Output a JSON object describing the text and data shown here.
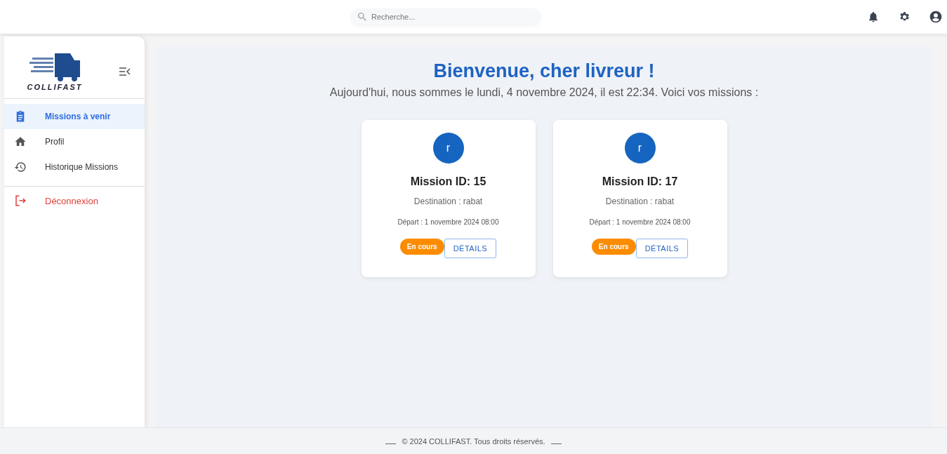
{
  "search": {
    "placeholder": "Recherche..."
  },
  "sidebar": {
    "logo_text": "COLLIFAST",
    "items": [
      {
        "label": "Missions à venir",
        "kind": "clipboard",
        "selected": true
      },
      {
        "label": "Profil",
        "kind": "home",
        "selected": false
      },
      {
        "label": "Historique Missions",
        "kind": "history",
        "selected": false
      }
    ],
    "logout": {
      "label": "Déconnexion"
    }
  },
  "main": {
    "title": "Bienvenue, cher livreur !",
    "subtitle": "Aujourd'hui, nous sommes le lundi, 4 novembre 2024, il est 22:34. Voici vos missions :",
    "missions": [
      {
        "avatar": "r",
        "title": "Mission ID: 15",
        "destination": "Destination : rabat",
        "departure": "Départ : 1 novembre 2024 08:00",
        "status": "En cours",
        "button": "DÉTAILS"
      },
      {
        "avatar": "r",
        "title": "Mission ID: 17",
        "destination": "Destination : rabat",
        "departure": "Départ : 1 novembre 2024 08:00",
        "status": "En cours",
        "button": "DÉTAILS"
      }
    ]
  },
  "footer": {
    "text": "© 2024 COLLIFAST. Tous droits réservés."
  }
}
